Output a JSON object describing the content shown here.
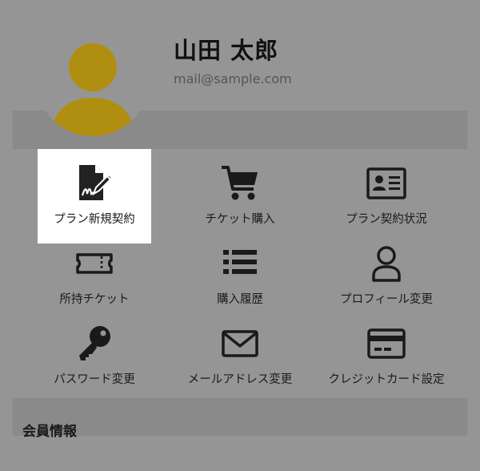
{
  "profile": {
    "name": "山田 太郎",
    "email": "mail@sample.com",
    "avatar_color": "#b08f10"
  },
  "menu": [
    {
      "label": "プラン新規契約",
      "icon": "contract-sign-icon",
      "active": true
    },
    {
      "label": "チケット購入",
      "icon": "shopping-cart-icon"
    },
    {
      "label": "プラン契約状況",
      "icon": "id-card-icon"
    },
    {
      "label": "所持チケット",
      "icon": "ticket-icon"
    },
    {
      "label": "購入履歴",
      "icon": "list-icon"
    },
    {
      "label": "プロフィール変更",
      "icon": "user-icon"
    },
    {
      "label": "パスワード変更",
      "icon": "key-icon"
    },
    {
      "label": "メールアドレス変更",
      "icon": "envelope-icon"
    },
    {
      "label": "クレジットカード設定",
      "icon": "credit-card-icon"
    }
  ],
  "section": {
    "title": "会員情報"
  },
  "colors": {
    "overlay": "#959595",
    "band": "#8a8a8a",
    "active_item": "#ffffff",
    "icon": "#1a1a1a"
  }
}
